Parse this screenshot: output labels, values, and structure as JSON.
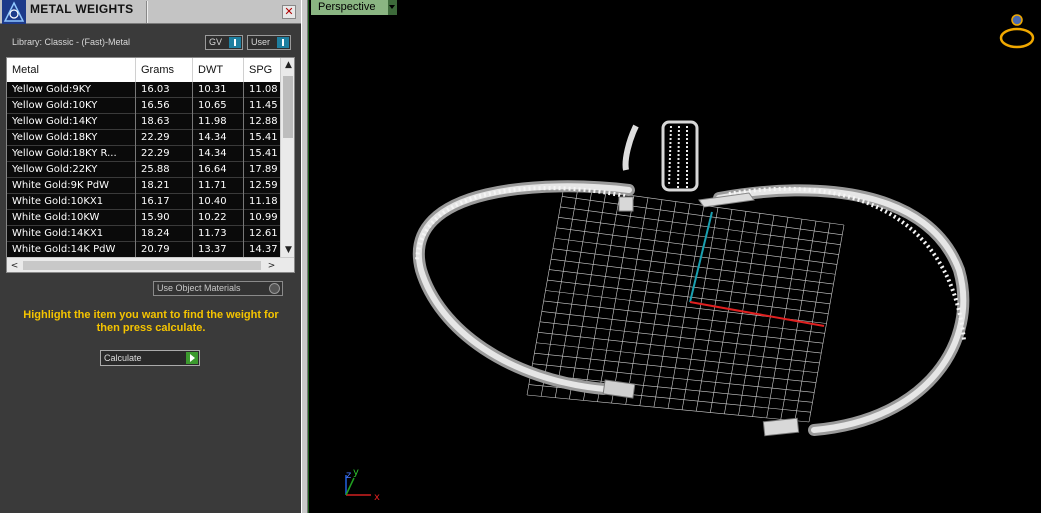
{
  "panel": {
    "title": "METAL WEIGHTS",
    "close_glyph": "✕",
    "library_label": "Library: Classic - (Fast)-Metal",
    "gv_dropdown": "GV",
    "user_dropdown": "User",
    "table": {
      "columns": [
        "Metal",
        "Grams",
        "DWT",
        "SPG"
      ],
      "rows": [
        [
          "Yellow Gold:9KY",
          "16.03",
          "10.31",
          "11.08"
        ],
        [
          "Yellow Gold:10KY",
          "16.56",
          "10.65",
          "11.45"
        ],
        [
          "Yellow Gold:14KY",
          "18.63",
          "11.98",
          "12.88"
        ],
        [
          "Yellow Gold:18KY",
          "22.29",
          "14.34",
          "15.41"
        ],
        [
          "Yellow Gold:18KY R...",
          "22.29",
          "14.34",
          "15.41"
        ],
        [
          "Yellow Gold:22KY",
          "25.88",
          "16.64",
          "17.89"
        ],
        [
          "White Gold:9K PdW",
          "18.21",
          "11.71",
          "12.59"
        ],
        [
          "White Gold:10KX1",
          "16.17",
          "10.40",
          "11.18"
        ],
        [
          "White Gold:10KW",
          "15.90",
          "10.22",
          "10.99"
        ],
        [
          "White Gold:14KX1",
          "18.24",
          "11.73",
          "12.61"
        ],
        [
          "White Gold:14K PdW",
          "20.79",
          "13.37",
          "14.37"
        ]
      ]
    },
    "scroll_up_glyph": "▲",
    "scroll_down_glyph": "▼",
    "scroll_left_glyph": "<",
    "scroll_right_glyph": ">",
    "use_object_materials": "Use Object Materials",
    "instruction": "Highlight the item you want to find the weight for then press calculate.",
    "calculate_label": "Calculate",
    "colors": {
      "panel_bg": "#3a3a3a",
      "instruction": "#f5c400",
      "row_bg": "#0a0a0a",
      "accent_blue": "#1e7fa0",
      "go_green": "#3c9a2e"
    }
  },
  "viewport": {
    "label": "Perspective",
    "axis_labels": {
      "z": "z",
      "y": "y",
      "x": "x"
    },
    "colors": {
      "tab_bg": "#8ab582",
      "grid": "#cfcfcf",
      "axis_x": "#e02020",
      "axis_y": "#1aa0b0",
      "ring_icon": "#f0a800"
    }
  }
}
